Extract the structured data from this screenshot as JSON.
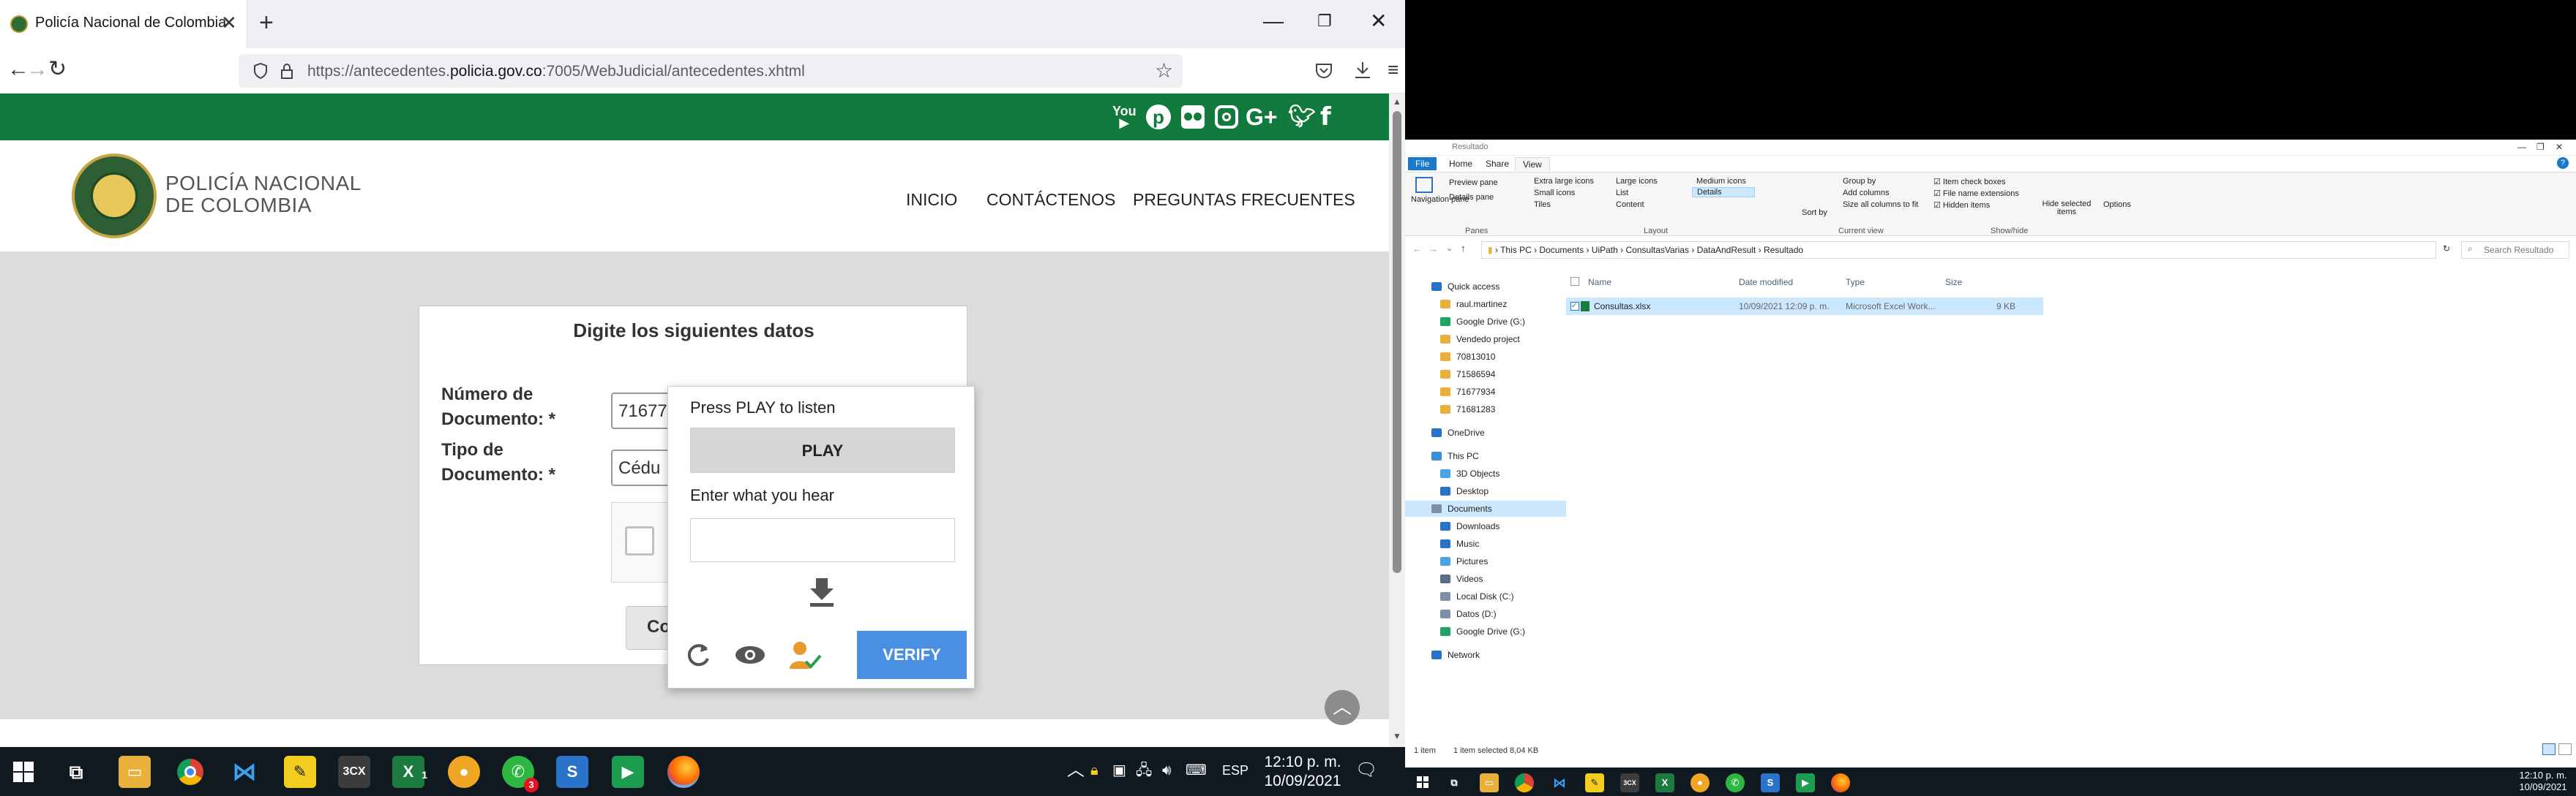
{
  "browser": {
    "tab_title": "Policía Nacional de Colombia",
    "url_prefix": "https://antecedentes.",
    "url_domain": "policia.gov.co",
    "url_suffix": ":7005/WebJudicial/antecedentes.xhtml"
  },
  "site": {
    "brand_line1": "POLICÍA NACIONAL",
    "brand_line2": "DE COLOMBIA",
    "menu": [
      "INICIO",
      "CONTÁCTENOS",
      "PREGUNTAS FRECUENTES"
    ],
    "social_icons": [
      "youtube-icon",
      "pinterest-icon",
      "flickr-icon",
      "instagram-icon",
      "google-plus-icon",
      "twitter-icon",
      "facebook-icon"
    ],
    "colors": {
      "green": "#117a3c",
      "verify": "#4a90e2"
    }
  },
  "form": {
    "title": "Digite los siguientes datos",
    "doc_number_label_1": "Número de",
    "doc_number_label_2": "Documento: *",
    "doc_number_value": "71677",
    "doc_type_label_1": "Tipo de",
    "doc_type_label_2": "Documento: *",
    "doc_type_value": "Cédu",
    "consult_label": "Co"
  },
  "captcha": {
    "press_play": "Press PLAY to listen",
    "play": "PLAY",
    "enter_hear": "Enter what you hear",
    "verify": "VERIFY"
  },
  "taskbar_left": {
    "time": "12:10 p. m.",
    "date": "10/09/2021",
    "lang": "ESP",
    "badge": "3",
    "badge2": "1"
  },
  "explorer": {
    "title": "Resultado",
    "tabs": [
      "File",
      "Home",
      "Share",
      "View"
    ],
    "ribbon": {
      "nav_pane": "Navigation pane",
      "preview_pane": "Preview pane",
      "details_pane": "Details pane",
      "extra_large": "Extra large icons",
      "large": "Large icons",
      "medium": "Medium icons",
      "small": "Small icons",
      "list": "List",
      "details": "Details",
      "tiles": "Tiles",
      "content": "Content",
      "sort_by": "Sort by",
      "group_by": "Group by",
      "add_columns": "Add columns",
      "size_all": "Size all columns to fit",
      "item_checkboxes": "Item check boxes",
      "file_ext": "File name extensions",
      "hidden_items": "Hidden items",
      "hide_selected": "Hide selected items",
      "options": "Options",
      "groups": [
        "Panes",
        "Layout",
        "Current view",
        "Show/hide"
      ]
    },
    "breadcrumb": [
      "This PC",
      "Documents",
      "UiPath",
      "ConsultasVarias",
      "DataAndResult",
      "Resultado"
    ],
    "search_placeholder": "Search Resultado",
    "nav_items": [
      "Quick access",
      "raul.martinez",
      "Google Drive (G:)",
      "Vendedo project",
      "70813010",
      "71586594",
      "71677934",
      "71681283",
      "OneDrive",
      "This PC",
      "3D Objects",
      "Desktop",
      "Documents",
      "Downloads",
      "Music",
      "Pictures",
      "Videos",
      "Local Disk (C:)",
      "Datos (D:)",
      "Google Drive (G:)",
      "Network"
    ],
    "columns": [
      "Name",
      "Date modified",
      "Type",
      "Size"
    ],
    "file": {
      "name": "Consultas.xlsx",
      "date": "10/09/2021 12:09 p. m.",
      "type": "Microsoft Excel Work...",
      "size": "9 KB"
    },
    "status_items": "1 item",
    "status_selected": "1 item selected  8,04 KB"
  },
  "taskbar_right": {
    "time": "12:10 p. m.",
    "date": "10/09/2021"
  }
}
